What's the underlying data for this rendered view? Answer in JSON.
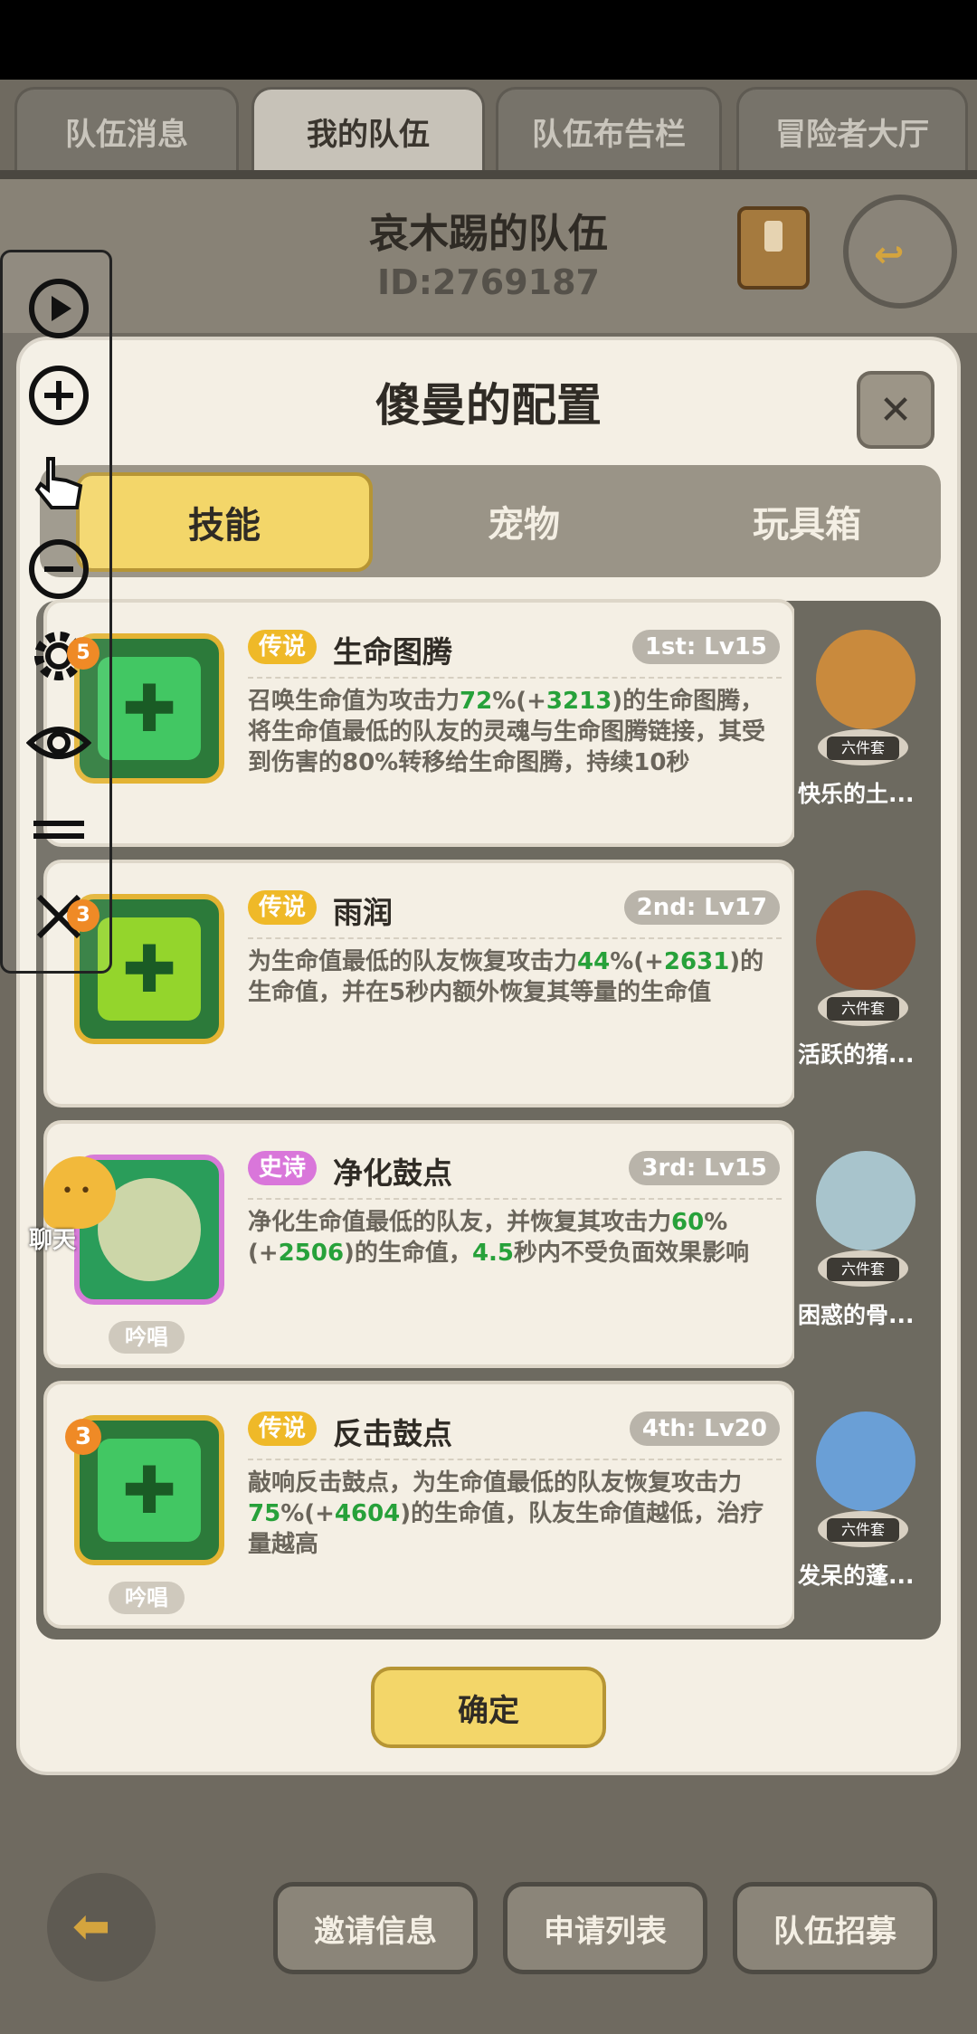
{
  "tabs": [
    "队伍消息",
    "我的队伍",
    "队伍布告栏",
    "冒险者大厅"
  ],
  "team": {
    "name": "哀木踢的队伍",
    "id": "ID:2769187"
  },
  "modal": {
    "title": "傻曼的配置",
    "subtabs": [
      "技能",
      "宠物",
      "玩具箱"
    ],
    "skills": [
      {
        "rarity": "传说",
        "name": "生命图腾",
        "slot": "1st: Lv15",
        "desc": [
          "召唤生命值为攻击力",
          "72",
          "%(+",
          "3213",
          ")的生命图腾，将生命值最低的队友的灵魂与生命图腾链接，其受到伤害的80%转移给生命图腾，持续10秒"
        ]
      },
      {
        "rarity": "传说",
        "name": "雨润",
        "slot": "2nd: Lv17",
        "desc": [
          "为生命值最低的队友恢复攻击力",
          "44",
          "%(+",
          "2631",
          ")的生命值，并在5秒内额外恢复其等量的生命值"
        ]
      },
      {
        "rarity": "史诗",
        "name": "净化鼓点",
        "slot": "3rd: Lv15",
        "chant": "吟唱",
        "desc": [
          "净化生命值最低的队友，并恢复其攻击力",
          "60",
          "%(+",
          "2506",
          ")的生命值，",
          "4.5",
          "秒内不受负面效果影响"
        ]
      },
      {
        "rarity": "传说",
        "name": "反击鼓点",
        "slot": "4th: Lv20",
        "chant": "吟唱",
        "desc": [
          "敲响反击鼓点，为生命值最低的队友恢复攻击力",
          "75",
          "%(+",
          "4604",
          ")的生命值，队友生命值越低，治疗量越高"
        ]
      }
    ],
    "pets": [
      {
        "name": "快乐的土...",
        "tag": "六件套"
      },
      {
        "name": "活跃的猪...",
        "tag": "六件套"
      },
      {
        "name": "困惑的骨...",
        "tag": "六件套"
      },
      {
        "name": "发呆的蓬...",
        "tag": "六件套"
      }
    ],
    "confirm": "确定"
  },
  "bottom": [
    "邀请信息",
    "申请列表",
    "队伍招募"
  ],
  "chat": "聊天",
  "badges": {
    "gear": "5",
    "close": "3",
    "skill4": "3"
  },
  "colors": {
    "legend": "#efb928",
    "epic": "#d976da",
    "highlight": "#27a13a",
    "confirm": "#f3d669"
  }
}
